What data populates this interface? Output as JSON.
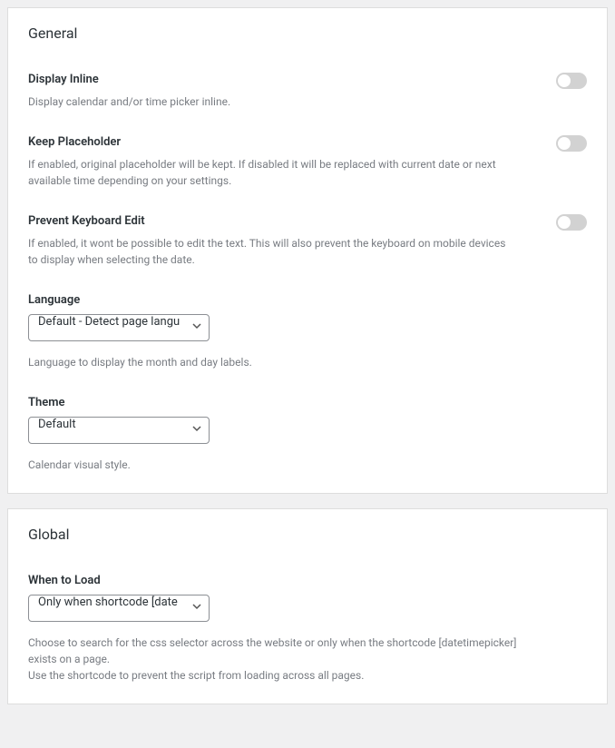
{
  "general": {
    "title": "General",
    "displayInline": {
      "label": "Display Inline",
      "desc": "Display calendar and/or time picker inline."
    },
    "keepPlaceholder": {
      "label": "Keep Placeholder",
      "desc": "If enabled, original placeholder will be kept. If disabled it will be replaced with current date or next available time depending on your settings."
    },
    "preventKeyboard": {
      "label": "Prevent Keyboard Edit",
      "desc": "If enabled, it wont be possible to edit the text. This will also prevent the keyboard on mobile devices to display when selecting the date."
    },
    "language": {
      "label": "Language",
      "selected": "Default - Detect page langu",
      "desc": "Language to display the month and day labels."
    },
    "theme": {
      "label": "Theme",
      "selected": "Default",
      "desc": "Calendar visual style."
    }
  },
  "global": {
    "title": "Global",
    "whenToLoad": {
      "label": "When to Load",
      "selected": "Only when shortcode [date",
      "desc1": "Choose to search for the css selector across the website or only when the shortcode [datetimepicker] exists on a page.",
      "desc2": "Use the shortcode to prevent the script from loading across all pages."
    }
  }
}
